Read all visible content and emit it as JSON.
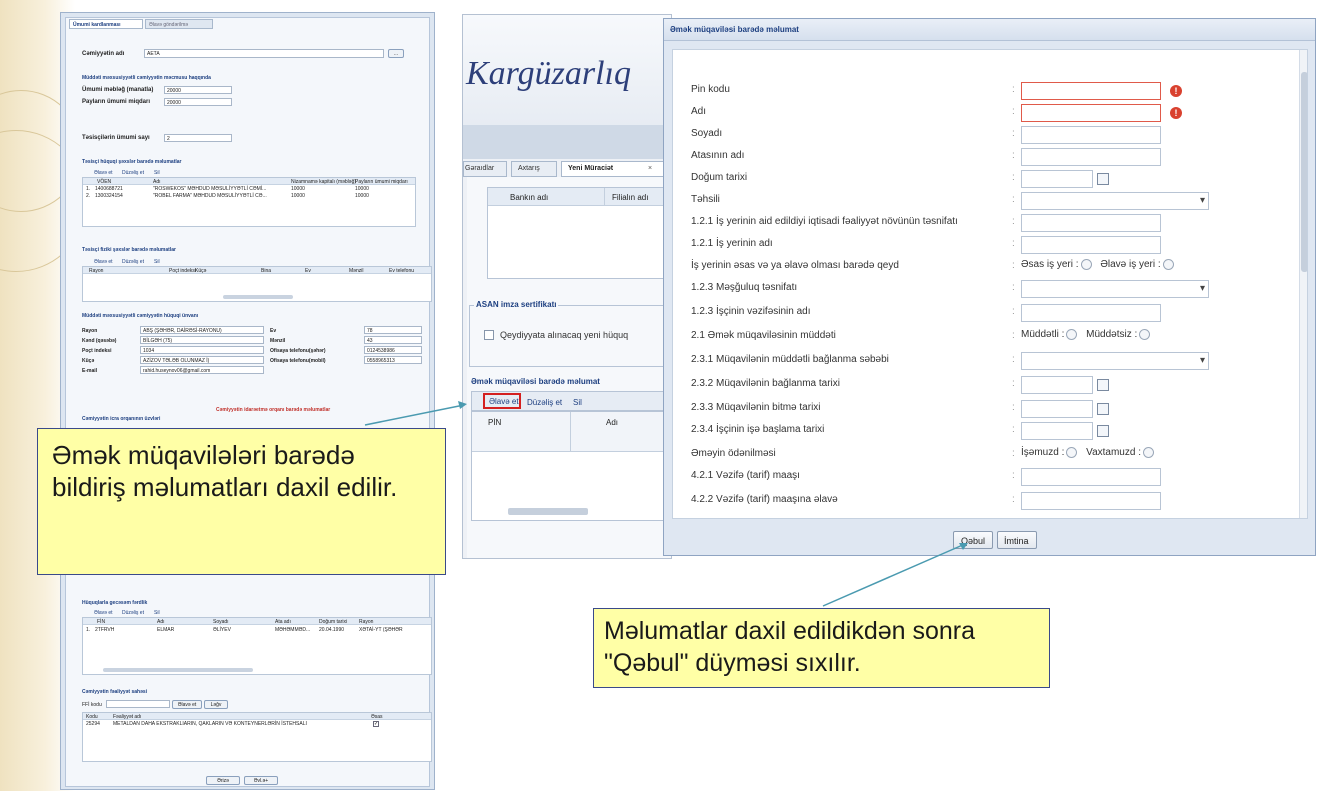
{
  "left_form": {
    "tabs": [
      "Ümumi kardlanması",
      "Əlavə göndərilmə"
    ],
    "employer_label": "Cəmiyyətin adı",
    "employer_value": "AETA",
    "section1_title": "Müddəti məxsusiyyətli cəmiyyətin məcmusu haqqında",
    "total_amount_label": "Ümumi məbləğ (manatla)",
    "total_amount_value": "20000",
    "shares_label": "Payların ümumi miqdarı",
    "shares_value": "20000",
    "founders_count_label": "Təsisçilərin ümumi sayı",
    "founders_count_value": "2",
    "founders_legal_title": "Təsisçi hüquqi şəxslər barədə məlumatlar",
    "grid_buttons": [
      "Əlavə et",
      "Düzəliş et",
      "Sil"
    ],
    "founders_legal_headers": [
      "VÖEN",
      "Adı",
      "Nizamnamə kapitalı (məbləğ)",
      "Payların ümumi miqdarı"
    ],
    "founders_legal_rows": [
      [
        "1400688721",
        "\"ROSWEKOS\" MƏHDUD MƏSULİYYƏTLİ CƏMİ...",
        "10000",
        "10000"
      ],
      [
        "1300324154",
        "\"ROBEL FARMA\" MƏHDUD MƏSULİYYƏTLİ CƏ...",
        "10000",
        "10000"
      ]
    ],
    "founders_phys_title": "Təsisçi fiziki şəxslər barədə məlumatlar",
    "founders_phys_headers": [
      "Rayon",
      "Poçt indeksi",
      "Küçə",
      "Bina",
      "Ev",
      "Mənzil",
      "Ev telefonu"
    ],
    "address_title": "Müddəti məxsusiyyətli cəmiyyətin hüquqi ünvanı",
    "address_left": [
      {
        "label": "Rayon",
        "value": "ABŞ (ŞƏHƏR, DAİRƏSİ-RAYONU)"
      },
      {
        "label": "Kənd (qəsəbə)",
        "value": "BİLGƏH (75)"
      },
      {
        "label": "Poçt indeksi",
        "value": "1034"
      },
      {
        "label": "Küçə",
        "value": "AZİZOV TƏLƏB OLUNMAZ İ)"
      },
      {
        "label": "E-mail",
        "value": "rahid.huseynov06@gmail.com"
      }
    ],
    "address_right": [
      {
        "label": "Ev",
        "value": "78"
      },
      {
        "label": "Mənzil",
        "value": "43"
      },
      {
        "label": "Ofisaya telefonu(şəhər)",
        "value": "0124538986"
      },
      {
        "label": "Ofisaya telefonu(mobil)",
        "value": "0558965313"
      }
    ],
    "bodies_red_title": "Cəmiyyətin idarəetmə orqanı barədə məlumatlar",
    "bodies_title": "Cəmiyyətin icra orqanının üzvləri",
    "hires_title": "Hüquqlarla gecəsəm fərdlik",
    "hires_headers": [
      "FİN",
      "Adı",
      "Soyadı",
      "Ata adı",
      "Doğum tarixi",
      "Rayon"
    ],
    "hires_row": [
      "2TFRVH",
      "ELMAR",
      "ƏLİYEV",
      "MƏHƏMMƏD...",
      "20.04.1990",
      "XƏTAİ-YT (ŞƏHƏR"
    ],
    "activity_title": "Cəmiyyətin fəaliyyət sahəsi",
    "activity_code_label": "FFİ kodu",
    "activity_buttons": [
      "Əlavə et",
      "Ləğv"
    ],
    "activity_headers": [
      "Kodu",
      "Fəaliyyət adı",
      "Əsas"
    ],
    "activity_row": [
      "25294",
      "METALDAN DAHA EKSTRAKLIARIN, QAKLARIN VƏ KONTEYNERLƏRİN İSTEHSALI"
    ],
    "bottom_buttons": [
      "Ərizə",
      "Əvl.ə+"
    ]
  },
  "app": {
    "title": "Kargüzarlıq",
    "tabs": [
      "Gəraıdlar",
      "Axtarış",
      "Yeni Müraciət"
    ],
    "bank_headers": [
      "Bankın adı",
      "Filialın adı"
    ],
    "asan_title": "ASAN imza sertifikatı",
    "asan_checkbox": "Qeydiyyata alınacaq yeni hüquq",
    "contract_title": "Əmək müqaviləsi barədə məlumat",
    "contract_buttons": [
      "Əlavə et",
      "Düzəliş et",
      "Sil"
    ],
    "contract_headers": [
      "PİN",
      "Adı"
    ]
  },
  "dialog": {
    "title": "Əmək müqaviləsi barədə məlumat",
    "fields": {
      "pin": "Pin kodu",
      "name": "Adı",
      "surname": "Soyadı",
      "father": "Atasının adı",
      "birth": "Doğum tarixi",
      "education": "Təhsili",
      "activity_class": "1.2.1 İş yerinin aid edildiyi iqtisadi fəaliyyət növünün təsnifatı",
      "workplace": "1.2.1 İş yerinin adı",
      "main_extra": "İş yerinin əsas və ya əlavə olması barədə qeyd",
      "occupation": "1.2.3 Məşğuluq təsnifatı",
      "position": "1.2.3 İşçinin vəzifəsinin adı",
      "term": "2.1 Əmək müqaviləsinin müddəti",
      "term_reason": "2.3.1 Müqavilənin müddətli bağlanma səbəbi",
      "sign_date": "2.3.2 Müqavilənin bağlanma tarixi",
      "end_date": "2.3.3 Müqavilənin bitmə tarixi",
      "start_date": "2.3.4 İşçinin işə başlama tarixi",
      "payment": "Əməyin ödənilməsi",
      "salary": "4.2.1 Vəzifə (tarif) maaşı",
      "salary_extra": "4.2.2 Vəzifə (tarif) maaşına əlavə"
    },
    "radios": {
      "main": "Əsas iş yeri :",
      "extra": "Əlavə iş yeri :",
      "fixed": "Müddətli :",
      "open": "Müddətsiz :",
      "piece": "İşəmuzd :",
      "time": "Vaxtamuzd :"
    },
    "accept": "Qəbul",
    "cancel": "İmtina"
  },
  "callouts": {
    "left": "Əmək müqavilələri barədə bildiriş məlumatları daxil edilir.",
    "right": "Məlumatlar daxil edildikdən sonra \"Qəbul\" düyməsi sıxılır."
  },
  "colors": {
    "callout_bg": "#ffffa6",
    "accent_blue": "#1d3f80",
    "error_red": "#d9412f",
    "highlight_red": "#d42020"
  }
}
